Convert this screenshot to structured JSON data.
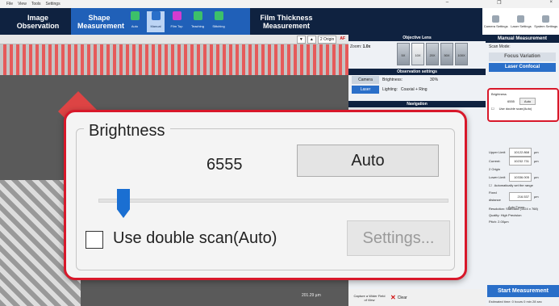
{
  "menu": [
    "File",
    "View",
    "Tools",
    "Settings"
  ],
  "window_controls": [
    "–",
    "❐",
    "×"
  ],
  "ribbon": {
    "tab_image": "Image Observation",
    "tab_shape": "Shape Measurement",
    "tab_film": "Film Thickness Measurement",
    "shape_buttons": [
      "Auto",
      "Manual",
      "Film Top",
      "Teaching",
      "Stitching"
    ],
    "right_buttons": [
      "Camera Settings",
      "Laser Settings",
      "System Settings"
    ]
  },
  "image_toolbar": {
    "origin": "2 Origin",
    "af": "AF"
  },
  "image": {
    "scale_label": "201.29 µm"
  },
  "objective": {
    "title": "Objective Lens",
    "zoom_label": "Zoom:",
    "zoom_value": "1.0x",
    "lenses": [
      "5X",
      "10X",
      "20X",
      "50X",
      "100X"
    ]
  },
  "observation": {
    "title": "Observation settings",
    "camera": "Camera",
    "laser": "Laser",
    "brightness_label": "Brightness:",
    "brightness_value": "30%",
    "lighting_label": "Lighting:",
    "lighting_value": "Coaxial + Ring"
  },
  "navigation": {
    "title": "Navigation"
  },
  "bottom": {
    "capture": "Capture a Wider Field of View",
    "clear": "Clear"
  },
  "manual": {
    "title": "Manual Measurement",
    "scan_mode_label": "Scan Mode:",
    "mode_focus": "Focus Variation",
    "mode_laser": "Laser Confocal",
    "brightness_small_title": "Brightness",
    "brightness_small_value": "6555",
    "brightness_small_auto": "Auto",
    "double_scan_small": "Use double scan(Auto)",
    "upper_limit_label": "Upper Limit",
    "upper_limit_value": "10122.868",
    "current_label": "Current:",
    "current_value": "10232.731",
    "origin_label": "2 Origin",
    "lower_limit_label": "Lower Limit",
    "lower_limit_value": "10336.005",
    "unit": "µm",
    "auto_range": "Automatically set the range",
    "fixed_distance_label": "Fixed distance",
    "fixed_distance_value": "216.537",
    "auto_focus": "Auto Focus",
    "resolution_label": "Resolution:",
    "resolution_value": "Standard (1024 x 768)",
    "quality_label": "Quality:",
    "quality_value": "High Precision",
    "pitch_label": "Pitch:",
    "pitch_value": "2.00µm",
    "start_button": "Start Measurement",
    "estimated_time": "Estimated time: 0 hours 0 min 28 sec"
  },
  "zoom_panel": {
    "group_title": "Brightness",
    "value": "6555",
    "auto_button": "Auto",
    "slider_level_percent": 9,
    "double_scan_label": "Use double scan(Auto)",
    "double_scan_checked": false,
    "settings_button": "Settings..."
  },
  "colors": {
    "highlight": "#d8182a",
    "accent": "#2a6fc9",
    "navy": "#0f2240",
    "slider_thumb": "#1a6fd2"
  }
}
